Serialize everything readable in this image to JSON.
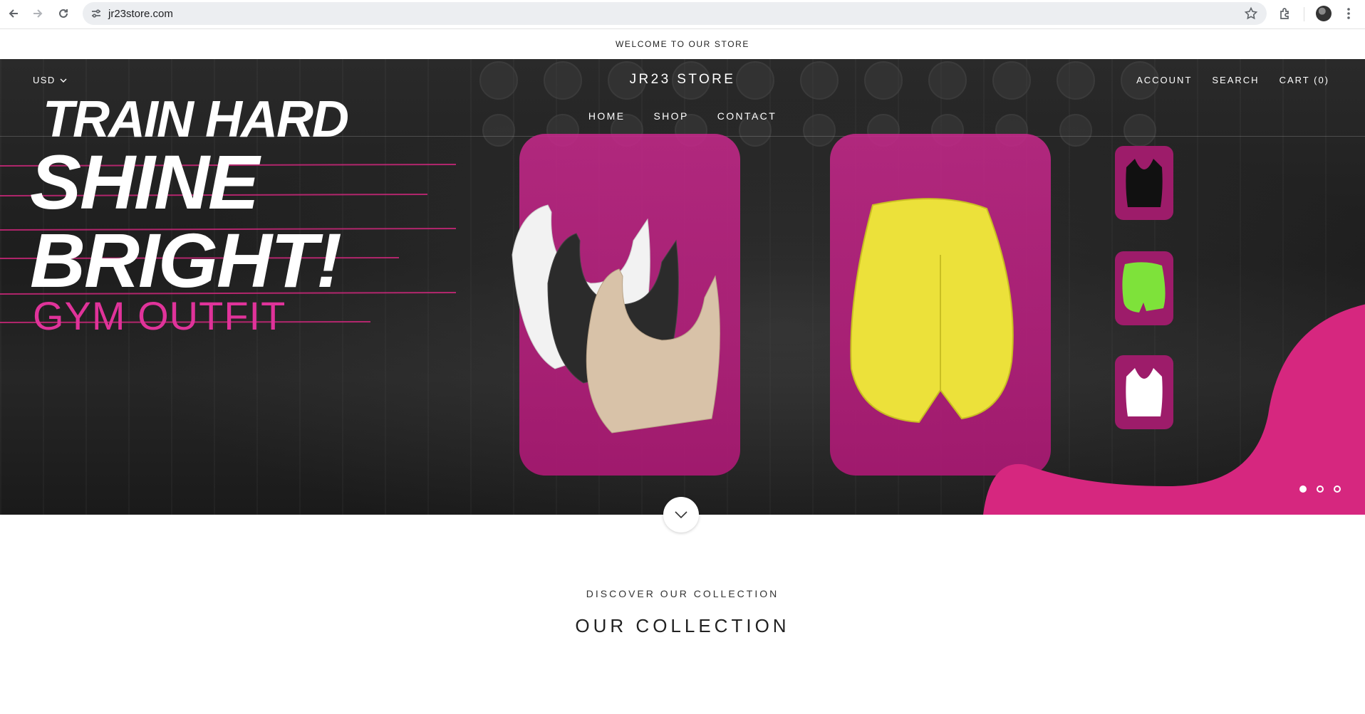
{
  "browser": {
    "url": "jr23store.com",
    "icons": [
      "back-icon",
      "forward-icon",
      "reload-icon",
      "site-settings-icon",
      "bookmark-star-icon",
      "extensions-icon",
      "profile-avatar",
      "more-menu-icon"
    ]
  },
  "announcement": {
    "text": "WELCOME TO OUR STORE"
  },
  "header": {
    "currency": "USD",
    "brand": "JR23 STORE",
    "nav": [
      "HOME",
      "SHOP",
      "CONTACT"
    ],
    "account": "ACCOUNT",
    "search": "SEARCH",
    "cart": "CART (0)"
  },
  "hero": {
    "headline_1": "TRAIN HARD",
    "headline_2": "SHINE",
    "headline_3": "BRIGHT!",
    "subheadline": "GYM OUTFIT",
    "accent_color": "#d6277f",
    "slides": 3,
    "active_slide": 1
  },
  "collection": {
    "subtitle": "DISCOVER OUR COLLECTION",
    "title": "OUR COLLECTION"
  }
}
